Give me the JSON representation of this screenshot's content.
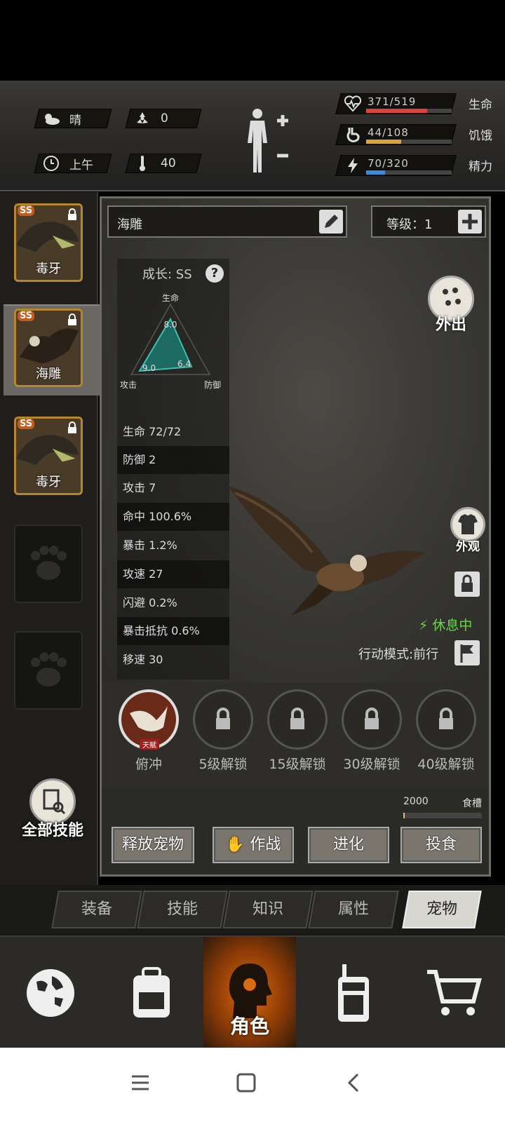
{
  "hud": {
    "weather": "晴",
    "radiation": "0",
    "time_of_day": "上午",
    "temperature": "40",
    "health": {
      "value": "371/519",
      "label": "生命",
      "fraction": 0.715,
      "color": "#d9453a"
    },
    "hunger": {
      "value": "44/108",
      "label": "饥饿",
      "fraction": 0.407,
      "color": "#d6a637"
    },
    "energy": {
      "value": "70/320",
      "label": "精力",
      "fraction": 0.219,
      "color": "#3d8ad6"
    }
  },
  "pets": [
    {
      "name": "毒牙",
      "rank": "SS"
    },
    {
      "name": "海雕",
      "rank": "SS"
    },
    {
      "name": "毒牙",
      "rank": "SS"
    }
  ],
  "all_skills_label": "全部技能",
  "panel": {
    "pet_name": "海雕",
    "level_text": "等级：1",
    "growth": "成长: SS",
    "radar": {
      "top_label": "生命",
      "left_label": "攻击",
      "right_label": "防御",
      "hp": "8.0",
      "atk": "9.0",
      "def": "6.4"
    },
    "stats": [
      "生命 72/72",
      "防御 2",
      "攻击 7",
      "命中 100.6%",
      "暴击 1.2%",
      "攻速 27",
      "闪避 0.2%",
      "暴击抵抗 0.6%",
      "移速 30"
    ],
    "go_out": "外出",
    "appearance": "外观",
    "status": "休息中",
    "action_mode": "行动模式:前行"
  },
  "skills": [
    {
      "label": "俯冲",
      "badge": "天赋"
    },
    {
      "label": "5级解锁"
    },
    {
      "label": "15级解锁"
    },
    {
      "label": "30级解锁"
    },
    {
      "label": "40级解锁"
    }
  ],
  "trough": {
    "value": "2000",
    "label": "食槽",
    "fraction": 0.02
  },
  "actions": {
    "release": "释放宠物",
    "battle": "作战",
    "evolve": "进化",
    "feed": "投食"
  },
  "tabs": [
    "装备",
    "技能",
    "知识",
    "属性",
    "宠物"
  ],
  "bottom_nav": {
    "character": "角色"
  }
}
